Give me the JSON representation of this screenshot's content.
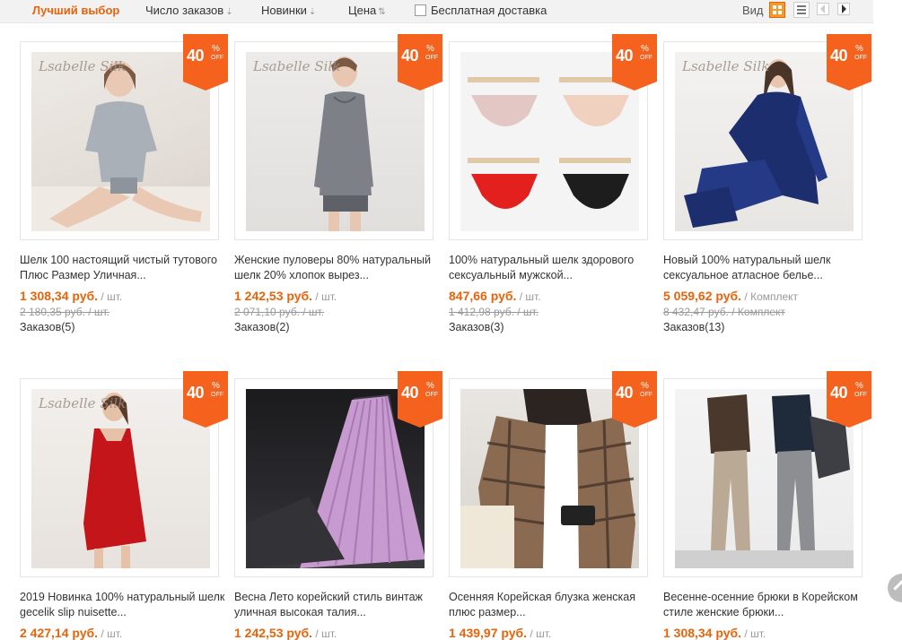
{
  "sort": {
    "best": "Лучший выбор",
    "orders": "Число заказов",
    "new": "Новинки",
    "price": "Цена",
    "free_shipping": "Бесплатная доставка",
    "view": "Вид"
  },
  "badge": {
    "num": "40",
    "pct": "%",
    "off": "OFF"
  },
  "products": [
    {
      "title": "Шелк 100 настоящий чистый тутового Плюс Размер Уличная...",
      "price": "1 308,34 руб.",
      "unit": " / шт.",
      "old": "2 180,35 руб. / шт.",
      "orders": "Заказов(5)",
      "logo": "Lsabelle Silk"
    },
    {
      "title": "Женские пуловеры 80% натуральный шелк 20% хлопок вырез...",
      "price": "1 242,53 руб.",
      "unit": " / шт.",
      "old": "2 071,10 руб. / шт.",
      "orders": "Заказов(2)",
      "logo": "Lsabelle Silk"
    },
    {
      "title": "100% натуральный шелк здорового сексуальный мужской...",
      "price": "847,66 руб.",
      "unit": " / шт.",
      "old": "1 412,98 руб. / шт.",
      "orders": "Заказов(3)",
      "logo": ""
    },
    {
      "title": "Новый 100% натуральный шелк сексуальное атласное белье...",
      "price": "5 059,62 руб.",
      "unit": " / Комплект",
      "old": "8 432,47 руб. / Комплект",
      "orders": "Заказов(13)",
      "logo": "Lsabelle Silk"
    },
    {
      "title": "2019 Новинка 100% натуральный шелк gecelik slip nuisette...",
      "price": "2 427,14 руб.",
      "unit": " / шт.",
      "old": "",
      "orders": "",
      "logo": "Lsabelle Silk"
    },
    {
      "title": "Весна Лето корейский стиль винтаж уличная высокая талия...",
      "price": "1 242,53 руб.",
      "unit": " / шт.",
      "old": "",
      "orders": "",
      "logo": ""
    },
    {
      "title": "Осенняя Корейская блузка женская плюс размер...",
      "price": "1 439,97 руб.",
      "unit": " / шт.",
      "old": "",
      "orders": "",
      "logo": ""
    },
    {
      "title": "Весенне-осенние брюки в Корейском стиле женские брюки...",
      "price": "1 308,34 руб.",
      "unit": " / шт.",
      "old": "",
      "orders": "",
      "logo": ""
    }
  ]
}
